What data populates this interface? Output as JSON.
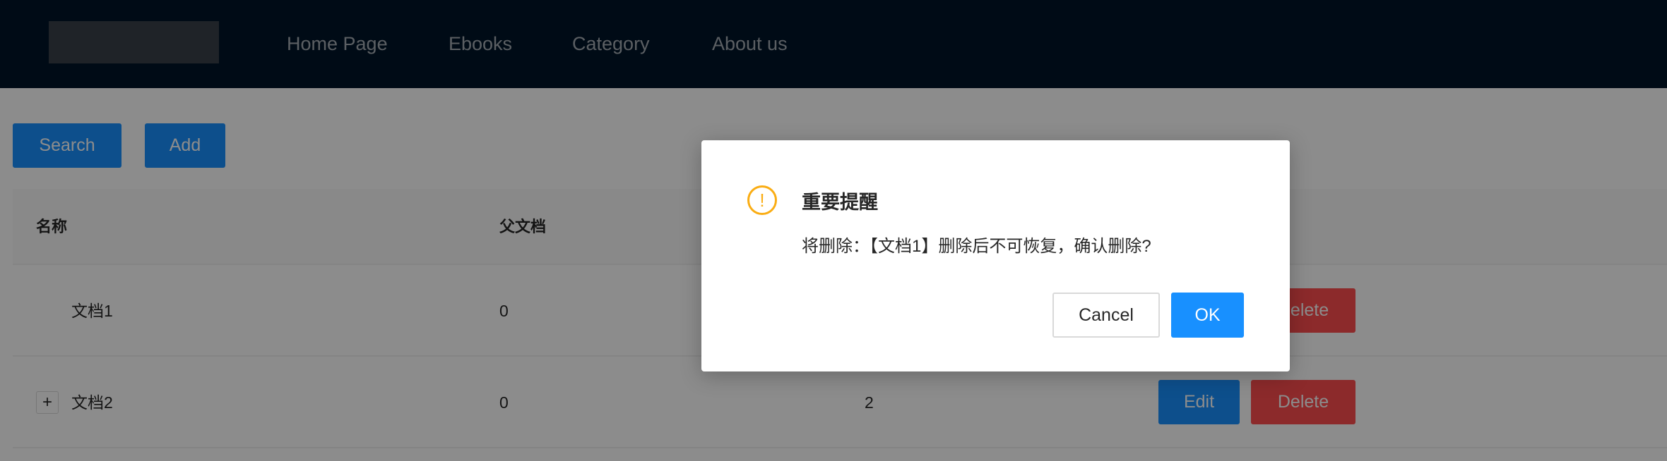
{
  "header": {
    "nav": [
      "Home Page",
      "Ebooks",
      "Category",
      "About us"
    ]
  },
  "toolbar": {
    "search_label": "Search",
    "add_label": "Add"
  },
  "table": {
    "columns": [
      "名称",
      "父文档"
    ],
    "rows": [
      {
        "name": "文档1",
        "parent": "0",
        "sort": "",
        "expandable": false
      },
      {
        "name": "文档2",
        "parent": "0",
        "sort": "2",
        "expandable": true
      }
    ],
    "edit_label": "Edit",
    "delete_label": "Delete",
    "expand_symbol": "+"
  },
  "modal": {
    "icon": "exclamation-circle-icon",
    "icon_glyph": "!",
    "title": "重要提醒",
    "content": "将删除：【文档1】删除后不可恢复，确认删除?",
    "cancel_label": "Cancel",
    "ok_label": "OK"
  },
  "colors": {
    "header": "#001529",
    "primary": "#1890ff",
    "danger": "#ff4d4f",
    "warning": "#faad14"
  }
}
